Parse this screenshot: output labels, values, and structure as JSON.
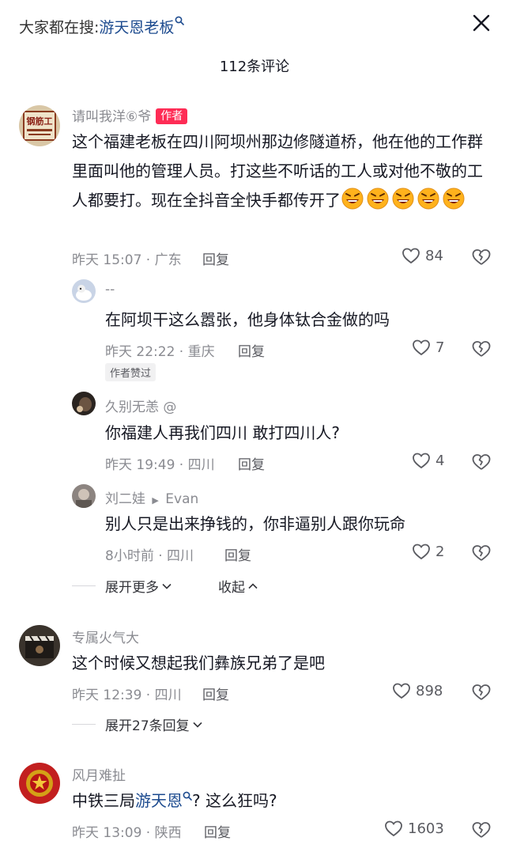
{
  "search": {
    "prefix": "大家都在搜:",
    "keyword": "游天恩老板"
  },
  "title": "112条评论",
  "comments": [
    {
      "user": "请叫我洋⑥爷",
      "badge": "作者",
      "text": "这个福建老板在四川阿坝州那边修隧道桥，他在他的工作群里面叫他的管理人员。打这些不听话的工人或对他不敬的工人都要打。现在全抖音全快手都传开了",
      "emoji_count": 5,
      "emoji_name": "angry-laugh-emoji",
      "time": "昨天 15:07 · 广东",
      "reply_label": "回复",
      "likes": "84",
      "avatar_text": "钢筋工",
      "replies": [
        {
          "user": "--",
          "text": "在阿坝干这么嚣张，他身体钛合金做的吗",
          "time": "昨天 22:22 · 重庆",
          "reply_label": "回复",
          "likes": "7",
          "tag": "作者赞过"
        },
        {
          "user": "久别无恙 @",
          "text": "你福建人再我们四川 敢打四川人?",
          "time": "昨天 19:49 · 四川",
          "reply_label": "回复",
          "likes": "4"
        },
        {
          "user": "刘二娃",
          "reply_to": "Evan",
          "text": "别人只是出来挣钱的，你非逼别人跟你玩命",
          "time": "8小时前 · 四川",
          "reply_label": "回复",
          "likes": "2"
        }
      ],
      "expand_label": "展开更多",
      "collapse_label": "收起"
    },
    {
      "user": "专属火气大",
      "text": "这个时候又想起我们彝族兄弟了是吧",
      "time": "昨天 12:39 · 四川",
      "reply_label": "回复",
      "likes": "898",
      "expand_label": "展开27条回复"
    },
    {
      "user": "风月难扯",
      "text_prefix": "中铁三局",
      "text_keyword": "游天恩",
      "text_suffix": "? 这么狂吗?",
      "time": "昨天 13:09 · 陕西",
      "reply_label": "回复",
      "likes": "1603"
    }
  ],
  "colors": {
    "author_badge": "#fe2c55",
    "link": "#1d4b8f",
    "meta": "#8a8b91"
  }
}
